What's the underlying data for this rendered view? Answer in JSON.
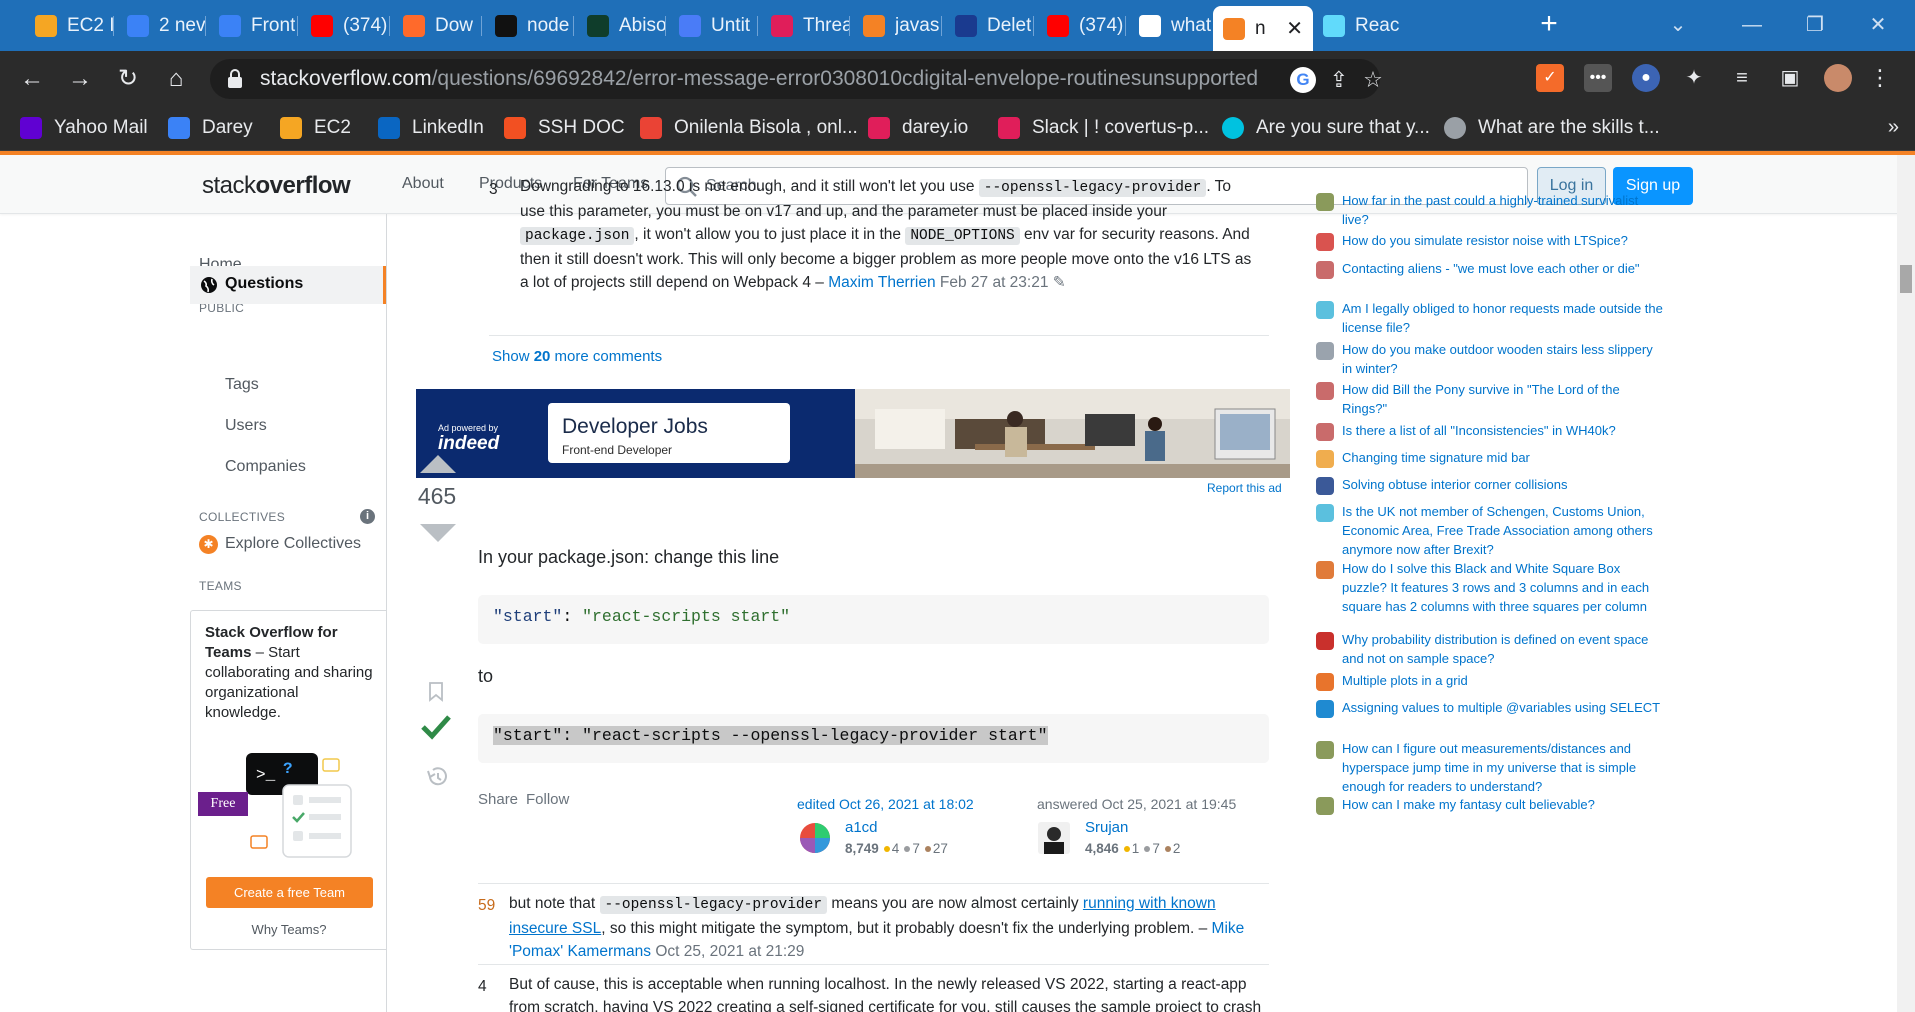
{
  "browser": {
    "tabs": [
      {
        "title": "EC2 I",
        "icon": "aws-cube-icon",
        "color": "#f5a623"
      },
      {
        "title": "2 nev",
        "icon": "darey-icon",
        "color": "#3b82f6"
      },
      {
        "title": "Front",
        "icon": "darey-icon",
        "color": "#3b82f6"
      },
      {
        "title": "(374)",
        "icon": "youtube-icon",
        "color": "#ff0000"
      },
      {
        "title": "Dow",
        "icon": "download-icon",
        "color": "#ff6a2b"
      },
      {
        "title": "node",
        "icon": "github-icon",
        "color": "#111111"
      },
      {
        "title": "Abiso",
        "icon": "mongodb-leaf-icon",
        "color": "#0f3d2b"
      },
      {
        "title": "Untit",
        "icon": "docs-icon",
        "color": "#4a7cf7"
      },
      {
        "title": "Threa",
        "icon": "slack-icon",
        "color": "#e01e5a"
      },
      {
        "title": "javas",
        "icon": "stackoverflow-icon",
        "color": "#f48225"
      },
      {
        "title": "Delet",
        "icon": "bookmark-i-icon",
        "color": "#1a3a8f"
      },
      {
        "title": "(374)",
        "icon": "youtube-icon",
        "color": "#ff0000"
      },
      {
        "title": "what",
        "icon": "google-icon",
        "color": "#ffffff"
      },
      {
        "title": "n",
        "icon": "stackoverflow-icon",
        "color": "#f48225"
      },
      {
        "title": "Reac",
        "icon": "react-icon",
        "color": "#61dafb"
      }
    ],
    "active_tab_index": 13,
    "url_host": "stackoverflow.com",
    "url_path": "/questions/69692842/error-message-error0308010cdigital-envelope-routinesunsupported",
    "bookmarks": [
      {
        "label": "Yahoo Mail",
        "icon": "yahoo-icon",
        "color": "#6001d2"
      },
      {
        "label": "Darey",
        "icon": "darey-icon",
        "color": "#3b82f6"
      },
      {
        "label": "EC2",
        "icon": "aws-cube-icon",
        "color": "#f5a623"
      },
      {
        "label": "LinkedIn",
        "icon": "linkedin-icon",
        "color": "#0a66c2"
      },
      {
        "label": "SSH DOC",
        "icon": "microsoft-icon",
        "color": "#f25022"
      },
      {
        "label": "Onilenla Bisola , onl...",
        "icon": "gmail-icon",
        "color": "#ea4335"
      },
      {
        "label": "darey.io",
        "icon": "slack-icon",
        "color": "#e01e5a"
      },
      {
        "label": "Slack | ! covertus-p...",
        "icon": "slack-icon",
        "color": "#e01e5a"
      },
      {
        "label": "Are you sure that y...",
        "icon": "circle-icon",
        "color": "#00c2e0"
      },
      {
        "label": "What are the skills t...",
        "icon": "globe-icon",
        "color": "#9aa0a6"
      }
    ]
  },
  "so_header": {
    "logo_light": "stack",
    "logo_bold": "overflow",
    "nav": [
      "About",
      "Products",
      "For Teams"
    ],
    "search_placeholder": "Search...",
    "login": "Log in",
    "signup": "Sign up"
  },
  "left_nav": {
    "home": "Home",
    "public_head": "PUBLIC",
    "questions": "Questions",
    "tags": "Tags",
    "users": "Users",
    "companies": "Companies",
    "collectives_head": "COLLECTIVES",
    "explore_collectives": "Explore Collectives",
    "teams_head": "TEAMS",
    "teams_title": "Stack Overflow for Teams",
    "teams_text": " – Start collaborating and sharing organizational knowledge.",
    "free_badge": "Free",
    "create_team": "Create a free Team",
    "why_teams": "Why Teams?"
  },
  "comments_top": {
    "score": "3",
    "text_1": "Downgrading to 16.13.0 is not enough, and it still won't let you use ",
    "code_1": "--openssl-legacy-provider",
    "text_2": ". To use this parameter, you must be on v17 and up, and the parameter must be placed inside your ",
    "code_2": "package.json",
    "text_3": ", it won't allow you to just place it in the ",
    "code_3": "NODE_OPTIONS",
    "text_4": " env var for security reasons. And then it still doesn't work. This will only become a bigger problem as more people move onto the v16 LTS as a lot of projects still depend on Webpack 4 – ",
    "author": "Maxim Therrien",
    "date": "Feb 27 at 23:21",
    "show_more_prefix": "Show ",
    "show_more_count": "20",
    "show_more_suffix": " more comments"
  },
  "ad": {
    "powered_by": "Ad powered by",
    "brand": "indeed",
    "title": "Developer Jobs",
    "subtitle": "Front-end Developer",
    "report": "Report this ad"
  },
  "answer": {
    "votes": "465",
    "intro": "In your package.json: change this line",
    "code_before_key": "\"start\"",
    "code_before_val": "\"react-scripts start\"",
    "to": "to",
    "code_after": "\"start\": \"react-scripts --openssl-legacy-provider start\"",
    "share": "Share",
    "follow": "Follow",
    "edited_label": "edited Oct 26, 2021 at 18:02",
    "editor_name": "a1cd",
    "editor_rep": "8,749",
    "editor_gold": "4",
    "editor_silver": "7",
    "editor_bronze": "27",
    "answered_label": "answered Oct 25, 2021 at 19:45",
    "author_name": "Srujan",
    "author_rep": "4,846",
    "author_gold": "1",
    "author_silver": "7",
    "author_bronze": "2"
  },
  "answer_comments": [
    {
      "score": "59",
      "pre": "but note that ",
      "code": "--openssl-legacy-provider",
      "mid": " means you are now almost certainly ",
      "link": "running with known insecure SSL",
      "post": ", so this might mitigate the symptom, but it probably doesn't fix the underlying problem. – ",
      "author": "Mike 'Pomax' Kamermans",
      "date": "Oct 25, 2021 at 21:29"
    },
    {
      "score": "4",
      "text": "But of cause, this is acceptable when running localhost. In the newly released VS 2022, starting a react-app from scratch, having VS 2022 creating a self-signed certificate for you, still causes the sample project to crash"
    }
  ],
  "hot_questions": [
    {
      "title": "How far in the past could a highly-trained survivalist live?",
      "site": "worldbuilding-icon",
      "color": "#8a9a5b"
    },
    {
      "title": "How do you simulate resistor noise with LTSpice?",
      "site": "electronics-icon",
      "color": "#d9534f"
    },
    {
      "title": "Contacting aliens - \"we must love each other or die\"",
      "site": "scifi-icon",
      "color": "#c96b6b"
    },
    {
      "title": "Am I legally obliged to honor requests made outside the license file?",
      "site": "opensource-icon",
      "color": "#5bc0de"
    },
    {
      "title": "How do you make outdoor wooden stairs less slippery in winter?",
      "site": "diy-icon",
      "color": "#9aa3ad"
    },
    {
      "title": "How did Bill the Pony survive in \"The Lord of the Rings?\"",
      "site": "scifi-icon",
      "color": "#c96b6b"
    },
    {
      "title": "Is there a list of all \"Inconsistencies\" in WH40k?",
      "site": "scifi-icon",
      "color": "#c96b6b"
    },
    {
      "title": "Changing time signature mid bar",
      "site": "music-icon",
      "color": "#f0ad4e"
    },
    {
      "title": "Solving obtuse interior corner collisions",
      "site": "gamedev-icon",
      "color": "#3b5998"
    },
    {
      "title": "Is the UK not member of Schengen, Customs Union, Economic Area, Free Trade Association among others anymore now after Brexit?",
      "site": "politics-icon",
      "color": "#5bc0de"
    },
    {
      "title": "How do I solve this Black and White Square Box puzzle? It features 3 rows and 3 columns and in each square has 2 columns with three squares per column",
      "site": "puzzling-icon",
      "color": "#e07b3a"
    },
    {
      "title": "Why probability distribution is defined on event space and not on sample space?",
      "site": "math-icon",
      "color": "#c9302c"
    },
    {
      "title": "Multiple plots in a grid",
      "site": "tex-icon",
      "color": "#e8742c"
    },
    {
      "title": "Assigning values to multiple @variables using SELECT",
      "site": "dba-icon",
      "color": "#1f8ad1"
    },
    {
      "title": "How can I figure out measurements/distances and hyperspace jump time in my universe that is simple enough for readers to understand?",
      "site": "worldbuilding-icon",
      "color": "#8a9a5b"
    },
    {
      "title": "How can I make my fantasy cult believable?",
      "site": "worldbuilding-icon",
      "color": "#8a9a5b"
    }
  ],
  "colors": {
    "so_orange": "#f48225",
    "link_blue": "#0074cc",
    "accepted_green": "#2f8a47",
    "chrome_tab_blue": "#1f6fb8"
  }
}
